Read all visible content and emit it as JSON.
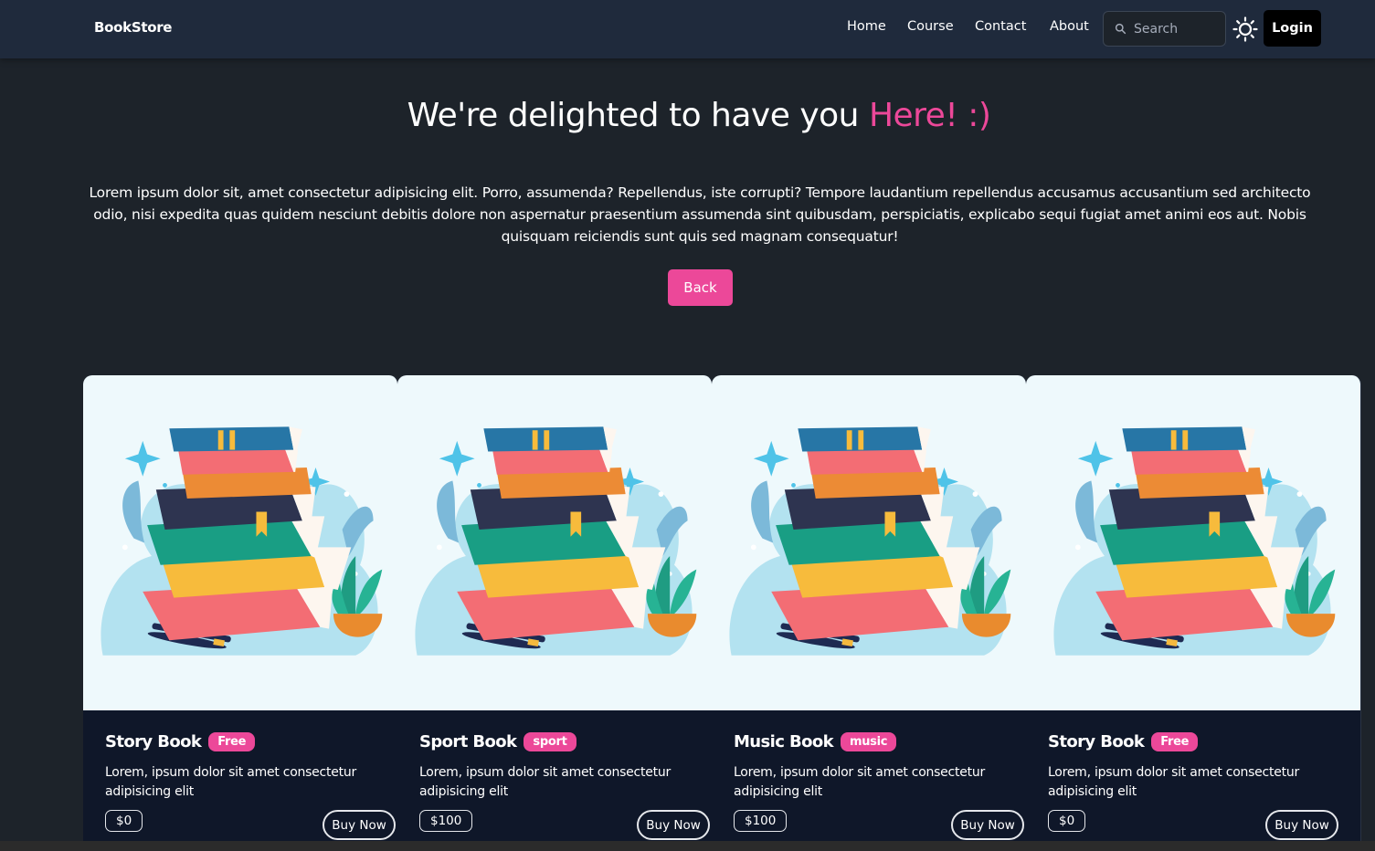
{
  "brand": "BookStore",
  "nav": {
    "links": [
      "Home",
      "Course",
      "Contact",
      "About"
    ],
    "search_placeholder": "Search",
    "login_label": "Login"
  },
  "hero": {
    "title": "We're delighted to have you",
    "title_accent": "Here! :)",
    "text": "Lorem ipsum dolor sit, amet consectetur adipisicing elit. Porro, assumenda? Repellendus, iste corrupti? Tempore laudantium repellendus accusamus accusantium sed architecto odio, nisi expedita quas quidem nesciunt debitis dolore non aspernatur praesentium assumenda sint quibusdam, perspiciatis, explicabo sequi fugiat amet animi eos aut. Nobis quisquam reiciendis sunt quis sed magnam consequatur!",
    "back_label": "Back"
  },
  "cards": [
    {
      "title": "Story Book",
      "badge": "Free",
      "desc": "Lorem, ipsum dolor sit amet consectetur adipisicing elit",
      "price": "$0",
      "buy": "Buy Now"
    },
    {
      "title": "Sport Book",
      "badge": "sport",
      "desc": "Lorem, ipsum dolor sit amet consectetur adipisicing elit",
      "price": "$100",
      "buy": "Buy Now"
    },
    {
      "title": "Music Book",
      "badge": "music",
      "desc": "Lorem, ipsum dolor sit amet consectetur adipisicing elit",
      "price": "$100",
      "buy": "Buy Now"
    },
    {
      "title": "Story Book",
      "badge": "Free",
      "desc": "Lorem, ipsum dolor sit amet consectetur adipisicing elit",
      "price": "$0",
      "buy": "Buy Now"
    }
  ],
  "colors": {
    "background": "#1d232a",
    "navbar": "#1f2a3c",
    "accent": "#ec4899",
    "card_body": "#0f1729",
    "card_image_bg": "#eef9fc"
  },
  "icons": {
    "search": "search-icon",
    "theme": "sun-icon",
    "illustration": "book-stack-illustration"
  }
}
